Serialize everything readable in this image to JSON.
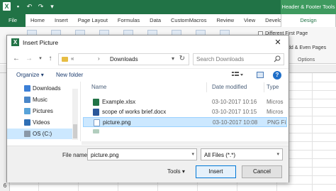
{
  "excel": {
    "tabs": [
      {
        "label": "File"
      },
      {
        "label": "Home"
      },
      {
        "label": "Insert"
      },
      {
        "label": "Page Layout"
      },
      {
        "label": "Formulas"
      },
      {
        "label": "Data"
      },
      {
        "label": "CustomMacros"
      },
      {
        "label": "Review"
      },
      {
        "label": "View"
      },
      {
        "label": "Developer"
      }
    ],
    "context_tools": "Header & Footer Tools",
    "design_tab": "Design",
    "options": {
      "different_first_page": "Different First Page",
      "odd_even_pages": "dd & Even Pages",
      "group_label": "Options"
    },
    "row_numbers": [
      "6"
    ],
    "accent": "#217346"
  },
  "dialog": {
    "title": "Insert Picture",
    "close_icon": "close-icon",
    "address": {
      "chevron": "«",
      "folder": "Downloads"
    },
    "search_placeholder": "Search Downloads",
    "toolbar": {
      "organize": "Organize",
      "new_folder": "New folder"
    },
    "sidebar": [
      {
        "label": "Downloads",
        "icon": "downloads-icon"
      },
      {
        "label": "Music",
        "icon": "music-icon"
      },
      {
        "label": "Pictures",
        "icon": "pictures-icon"
      },
      {
        "label": "Videos",
        "icon": "videos-icon"
      },
      {
        "label": "OS (C:)",
        "icon": "drive-icon"
      }
    ],
    "columns": {
      "name": "Name",
      "date": "Date modified",
      "type": "Type"
    },
    "files": [
      {
        "name": "Example.xlsx",
        "date": "03-10-2017 10:16",
        "type": "Micros",
        "icon": "excel-file-icon"
      },
      {
        "name": "scope of works brief.docx",
        "date": "03-10-2017 10:15",
        "type": "Micros",
        "icon": "word-file-icon"
      },
      {
        "name": "picture.png",
        "date": "03-10-2017 10:08",
        "type": "PNG Fi",
        "icon": "image-file-icon"
      }
    ],
    "file_name_label": "File name:",
    "file_name_value": "picture.png",
    "file_type_value": "All Files (*.*)",
    "tools_label": "Tools",
    "insert_label": "Insert",
    "cancel_label": "Cancel"
  }
}
